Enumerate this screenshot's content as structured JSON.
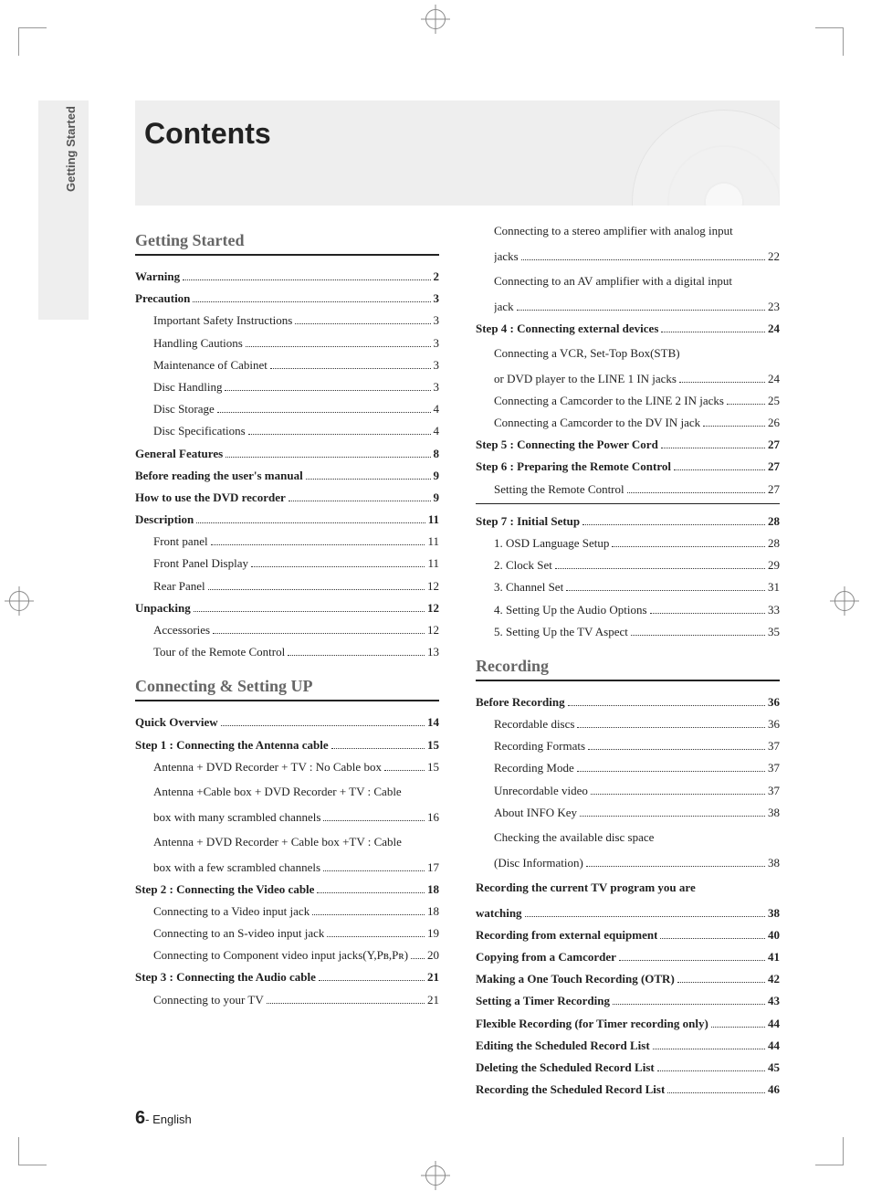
{
  "side_tab": "Getting Started",
  "title": "Contents",
  "footer": {
    "page": "6",
    "sep": "- ",
    "lang": "English"
  },
  "sections": {
    "getting_started": "Getting Started",
    "connecting": "Connecting & Setting UP",
    "recording": "Recording"
  },
  "col1": [
    {
      "section": "getting_started"
    },
    {
      "t": "Warning",
      "p": "2",
      "b": true
    },
    {
      "t": "Precaution",
      "p": "3",
      "b": true
    },
    {
      "t": "Important Safety Instructions",
      "p": "3",
      "i": true
    },
    {
      "t": "Handling Cautions",
      "p": "3",
      "i": true
    },
    {
      "t": "Maintenance of Cabinet",
      "p": "3",
      "i": true
    },
    {
      "t": "Disc Handling",
      "p": "3",
      "i": true
    },
    {
      "t": "Disc Storage",
      "p": "4",
      "i": true
    },
    {
      "t": "Disc Specifications",
      "p": "4",
      "i": true
    },
    {
      "t": "General Features",
      "p": "8",
      "b": true
    },
    {
      "t": "Before reading the user's manual",
      "p": "9",
      "b": true
    },
    {
      "t": "How to use the DVD recorder",
      "p": "9",
      "b": true
    },
    {
      "t": "Description",
      "p": "11",
      "b": true
    },
    {
      "t": "Front panel",
      "p": "11",
      "i": true
    },
    {
      "t": "Front Panel Display",
      "p": "11",
      "i": true
    },
    {
      "t": "Rear Panel",
      "p": "12",
      "i": true
    },
    {
      "t": "Unpacking",
      "p": "12",
      "b": true
    },
    {
      "t": "Accessories",
      "p": "12",
      "i": true
    },
    {
      "t": "Tour of the Remote Control",
      "p": "13",
      "i": true
    },
    {
      "section": "connecting"
    },
    {
      "t": "Quick Overview",
      "p": "14",
      "b": true
    },
    {
      "t": "Step 1 : Connecting the Antenna cable",
      "p": "15",
      "b": true
    },
    {
      "t": "Antenna + DVD Recorder + TV : No Cable box",
      "p": "15",
      "i": true
    },
    {
      "wrap": true,
      "i": true,
      "text": "Antenna +Cable box + DVD Recorder + TV : Cable"
    },
    {
      "t": "box with many scrambled channels",
      "p": "16",
      "i": true
    },
    {
      "wrap": true,
      "i": true,
      "text": "Antenna + DVD Recorder + Cable box +TV : Cable"
    },
    {
      "t": "box with a few scrambled channels",
      "p": "17",
      "i": true
    },
    {
      "t": "Step 2 : Connecting the Video cable",
      "p": "18",
      "b": true
    },
    {
      "t": "Connecting to a Video input jack",
      "p": "18",
      "i": true
    },
    {
      "t": "Connecting to an S-video input jack",
      "p": "19",
      "i": true
    },
    {
      "t": "Connecting to Component video input jacks(Y,Pʙ,Pʀ)",
      "p": "20",
      "i": true
    },
    {
      "t": "Step 3 : Connecting the Audio cable",
      "p": "21",
      "b": true
    },
    {
      "t": "Connecting to your TV",
      "p": "21",
      "i": true
    }
  ],
  "col2": [
    {
      "wrap": true,
      "i": true,
      "text": "Connecting to a stereo amplifier with analog input"
    },
    {
      "t": "jacks",
      "p": "22",
      "i": true
    },
    {
      "wrap": true,
      "i": true,
      "text": "Connecting to an AV amplifier with a digital input"
    },
    {
      "t": "jack",
      "p": "23",
      "i": true
    },
    {
      "t": "Step 4 : Connecting external devices",
      "p": "24",
      "b": true
    },
    {
      "wrap": true,
      "i": true,
      "text": "Connecting a VCR, Set-Top Box(STB)"
    },
    {
      "t": "or DVD player to the LINE 1 IN jacks",
      "p": "24",
      "i": true
    },
    {
      "t": "Connecting a Camcorder to the LINE 2 IN  jacks",
      "p": "25",
      "i": true
    },
    {
      "t": "Connecting a Camcorder to the DV IN jack",
      "p": "26",
      "i": true
    },
    {
      "t": "Step 5 : Connecting the Power Cord",
      "p": "27",
      "b": true
    },
    {
      "t": "Step 6 : Preparing the Remote Control",
      "p": "27",
      "b": true
    },
    {
      "t": "Setting the Remote Control",
      "p": "27",
      "i": true,
      "subrule": true
    },
    {
      "t": "Step 7 : Initial Setup",
      "p": "28",
      "b": true
    },
    {
      "t": "1. OSD Language Setup",
      "p": "28",
      "i": true
    },
    {
      "t": "2. Clock Set",
      "p": "29",
      "i": true
    },
    {
      "t": "3. Channel Set",
      "p": "31",
      "i": true
    },
    {
      "t": "4. Setting Up the Audio Options",
      "p": "33",
      "i": true
    },
    {
      "t": "5. Setting Up the TV Aspect",
      "p": "35",
      "i": true
    },
    {
      "section": "recording"
    },
    {
      "t": "Before Recording",
      "p": "36",
      "b": true
    },
    {
      "t": "Recordable discs",
      "p": "36",
      "i": true
    },
    {
      "t": "Recording Formats",
      "p": "37",
      "i": true
    },
    {
      "t": "Recording Mode",
      "p": "37",
      "i": true
    },
    {
      "t": "Unrecordable video",
      "p": "37",
      "i": true
    },
    {
      "t": "About INFO Key",
      "p": "38",
      "i": true
    },
    {
      "wrap": true,
      "i": true,
      "text": "Checking the available disc space"
    },
    {
      "t": "(Disc Information)",
      "p": "38",
      "i": true
    },
    {
      "wrap": true,
      "b": true,
      "text": "Recording the current TV program you are"
    },
    {
      "t": "watching",
      "p": "38",
      "b": true
    },
    {
      "t": "Recording from external equipment",
      "p": "40",
      "b": true
    },
    {
      "t": "Copying from a Camcorder",
      "p": "41",
      "b": true
    },
    {
      "t": "Making a One Touch Recording (OTR)",
      "p": "42",
      "b": true
    },
    {
      "t": "Setting a Timer Recording",
      "p": "43",
      "b": true
    },
    {
      "t": "Flexible Recording (for Timer recording only)",
      "p": "44",
      "b": true
    },
    {
      "t": "Editing the Scheduled Record List",
      "p": "44",
      "b": true
    },
    {
      "t": "Deleting the Scheduled Record List",
      "p": "45",
      "b": true
    },
    {
      "t": "Recording the Scheduled Record List",
      "p": "46",
      "b": true
    }
  ]
}
